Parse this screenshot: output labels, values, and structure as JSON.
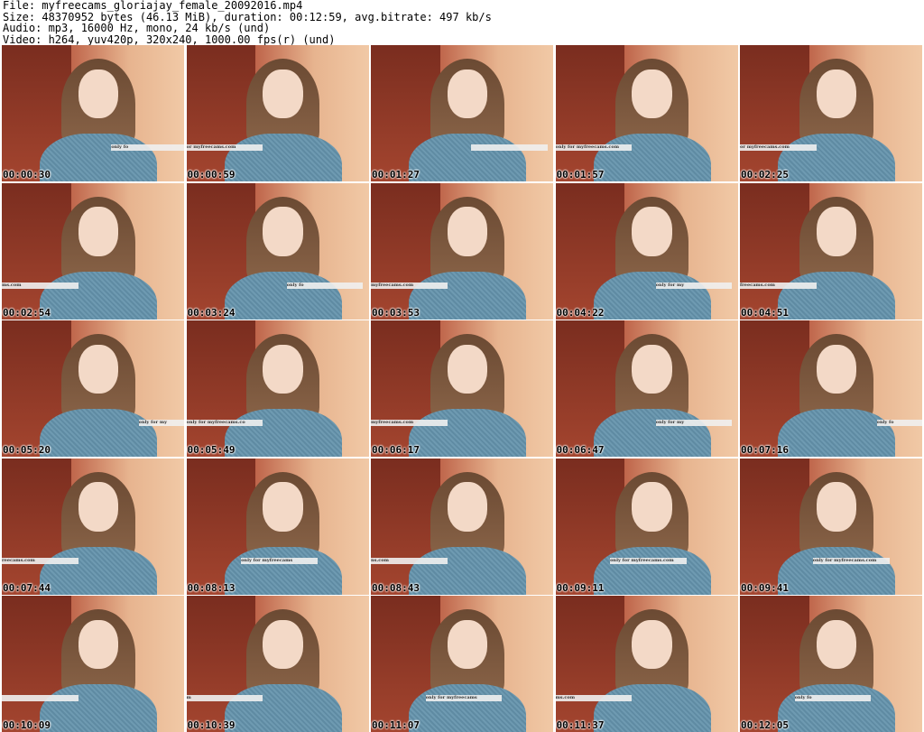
{
  "header": {
    "file": "File: myfreecams_gloriajay_female_20092016.mp4",
    "size": "Size: 48370952 bytes (46.13 MiB), duration: 00:12:59, avg.bitrate: 497 kb/s",
    "audio": "Audio: mp3, 16000 Hz, mono, 24 kb/s (und)",
    "video": "Video: h264, yuv420p, 320x240, 1000.00 fps(r) (und)"
  },
  "frames": [
    {
      "time": "00:00:30",
      "banner": "only fo"
    },
    {
      "time": "00:00:59",
      "banner": "or myfreecams.com"
    },
    {
      "time": "00:01:27",
      "banner": ""
    },
    {
      "time": "00:01:57",
      "banner": "only for myfreecams.com"
    },
    {
      "time": "00:02:25",
      "banner": "or myfreecams.com"
    },
    {
      "time": "00:02:54",
      "banner": "ms.com"
    },
    {
      "time": "00:03:24",
      "banner": "only fo"
    },
    {
      "time": "00:03:53",
      "banner": "myfreecams.com"
    },
    {
      "time": "00:04:22",
      "banner": "only for my"
    },
    {
      "time": "00:04:51",
      "banner": "freecams.com"
    },
    {
      "time": "00:05:20",
      "banner": "only for my"
    },
    {
      "time": "00:05:49",
      "banner": "only for myfreecams.co"
    },
    {
      "time": "00:06:17",
      "banner": "myfreecams.com"
    },
    {
      "time": "00:06:47",
      "banner": "only for my"
    },
    {
      "time": "00:07:16",
      "banner": "only fo"
    },
    {
      "time": "00:07:44",
      "banner": "reecams.com"
    },
    {
      "time": "00:08:13",
      "banner": "only for myfreecams"
    },
    {
      "time": "00:08:43",
      "banner": "ns.com"
    },
    {
      "time": "00:09:11",
      "banner": "only for myfreecams.com"
    },
    {
      "time": "00:09:41",
      "banner": "only for myfreecams.com"
    },
    {
      "time": "00:10:09",
      "banner": ""
    },
    {
      "time": "00:10:39",
      "banner": "m"
    },
    {
      "time": "00:11:07",
      "banner": "only for myfreecams"
    },
    {
      "time": "00:11:37",
      "banner": "ms.com"
    },
    {
      "time": "00:12:05",
      "banner": "only fo"
    }
  ]
}
